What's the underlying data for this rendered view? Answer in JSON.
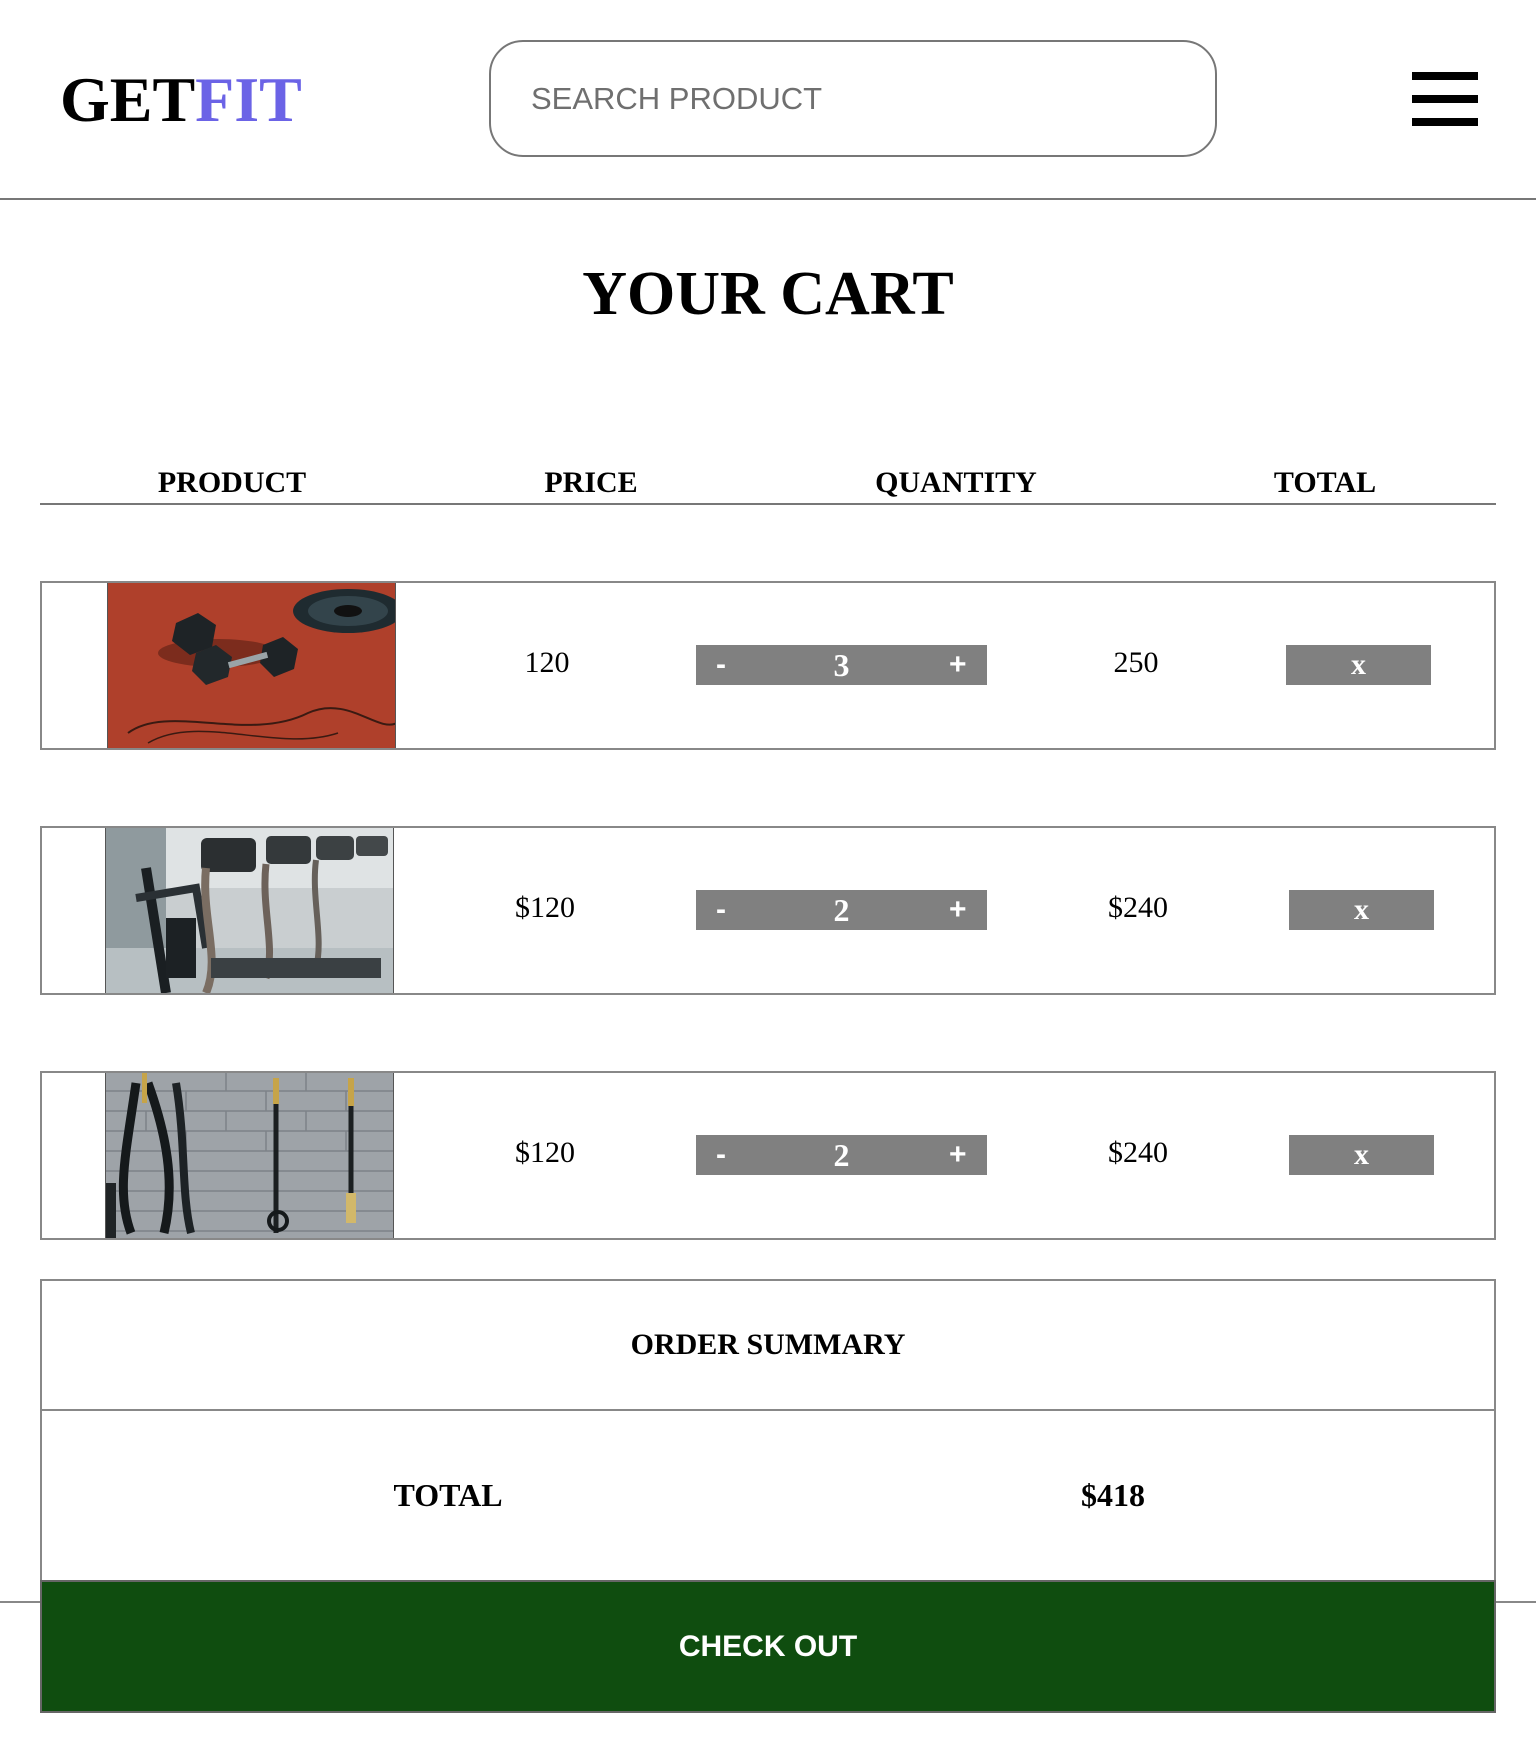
{
  "brand": {
    "part1": "GET",
    "part2": "FIT",
    "accent_color": "#6b63e6"
  },
  "search": {
    "placeholder": "SEARCH PRODUCT",
    "value": ""
  },
  "menu_icon": "hamburger-menu-icon",
  "page": {
    "title": "YOUR CART"
  },
  "table": {
    "headers": [
      "PRODUCT",
      "PRICE",
      "QUANTITY",
      "TOTAL"
    ],
    "rows": [
      {
        "image": "dumbbells on red track",
        "price": "120",
        "quantity": "3",
        "total": "250",
        "minus": "-",
        "plus": "+",
        "remove": "x"
      },
      {
        "image": "treadmills in gym",
        "price": "$120",
        "quantity": "2",
        "total": "$240",
        "minus": "-",
        "plus": "+",
        "remove": "x"
      },
      {
        "image": "battle ropes and suspension straps on brick wall",
        "price": "$120",
        "quantity": "2",
        "total": "$240",
        "minus": "-",
        "plus": "+",
        "remove": "x"
      }
    ]
  },
  "summary": {
    "title": "ORDER SUMMARY",
    "total_label": "TOTAL",
    "total_value": "$418"
  },
  "checkout": {
    "label": "CHECK OUT",
    "color": "#0f4d0f"
  },
  "colors": {
    "qty_bg": "#808080",
    "border": "#888888"
  }
}
